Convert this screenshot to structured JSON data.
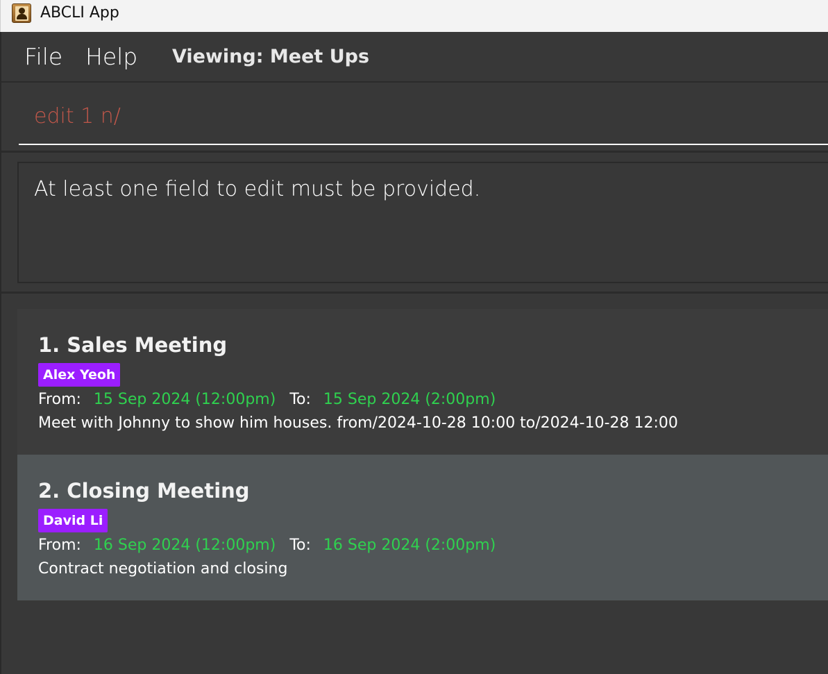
{
  "window": {
    "title": "ABCLI App",
    "icon": "address-book-icon"
  },
  "menubar": {
    "file_label": "File",
    "help_label": "Help",
    "viewing_label": "Viewing: Meet Ups"
  },
  "command": {
    "value": "edit 1 n/",
    "text_color": "#c1574a"
  },
  "result": {
    "message": "At least one field to edit must be provided."
  },
  "meetups": [
    {
      "title": "1. Sales Meeting",
      "tag": "Alex Yeoh",
      "from_label": "From:",
      "from": "15 Sep 2024 (12:00pm)",
      "to_label": "To:",
      "to": "15 Sep 2024 (2:00pm)",
      "description": "Meet with Johnny to show him houses. from/2024-10-28 10:00 to/2024-10-28 12:00"
    },
    {
      "title": "2. Closing Meeting",
      "tag": "David Li",
      "from_label": "From:",
      "from": "16 Sep 2024 (12:00pm)",
      "to_label": "To:",
      "to": "16 Sep 2024 (2:00pm)",
      "description": "Contract negotiation and closing"
    }
  ],
  "colors": {
    "background": "#383838",
    "tag": "#9b1eff",
    "datetime": "#2fd14f",
    "selected_card": "#515658"
  }
}
